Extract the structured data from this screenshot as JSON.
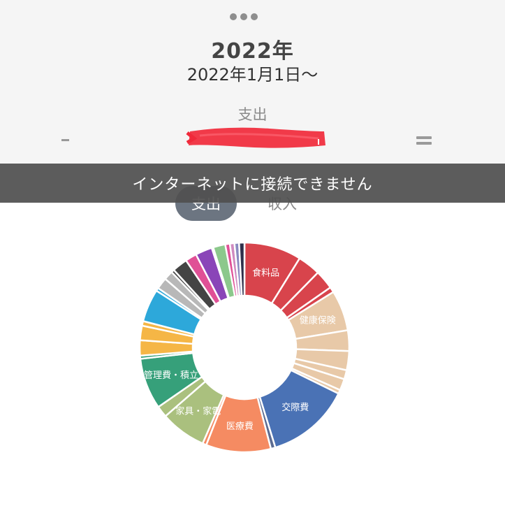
{
  "header": {
    "title": "2022年",
    "date_range": "2022年1月1日〜",
    "type_label": "支出"
  },
  "toggle": {
    "active_label": "支出",
    "inactive_label": "収入"
  },
  "toast": {
    "message": "インターネットに接続できません"
  },
  "colors": {
    "header_bg": "#f5f5f5",
    "toast_bg": "#505050",
    "pill_active": "#6c7581",
    "redaction": "#f0293a"
  },
  "chart_data": {
    "type": "pie",
    "categories": [
      "食料品",
      "",
      "",
      "",
      "健康保険",
      "",
      "",
      "",
      "",
      "",
      "交際費",
      "",
      "医療費",
      "",
      "家具・家電",
      "",
      "管理費・積立",
      "",
      "",
      "",
      "",
      "",
      "",
      "",
      "",
      "",
      "",
      "",
      "",
      "",
      "",
      "",
      "",
      "",
      ""
    ],
    "values": [
      7.5,
      3,
      2.5,
      0.7,
      5.3,
      2.7,
      2.5,
      1.2,
      1.5,
      0.5,
      11,
      0.6,
      8.5,
      0.5,
      6,
      1.5,
      6.7,
      0.4,
      2,
      1.9,
      0.6,
      4.3,
      0.4,
      1.5,
      1.2,
      0.4,
      2,
      1.5,
      2.2,
      0.2,
      1.6,
      0.6,
      0.6,
      0.6,
      0.7
    ],
    "colors": [
      "#d8444c",
      "#d8444c",
      "#d8444c",
      "#d8444c",
      "#e8c9a8",
      "#e8c9a8",
      "#e8c9a8",
      "#e8c9a8",
      "#e8c9a8",
      "#e8c9a8",
      "#4a72b5",
      "#5c6c92",
      "#f58b62",
      "#f58b62",
      "#aac07e",
      "#aac07e",
      "#36a07a",
      "#36a07a",
      "#f5b646",
      "#f5b646",
      "#f5b646",
      "#2da8da",
      "#2da8da",
      "#b8b8b8",
      "#b8b8b8",
      "#444444",
      "#444444",
      "#e05096",
      "#8a45b8",
      "#8a45b8",
      "#8cc88c",
      "#e05096",
      "#d08ac0",
      "#8a8ac0",
      "#2f2f4a"
    ],
    "label_indices": [
      0,
      4,
      10,
      12,
      14,
      16
    ]
  }
}
